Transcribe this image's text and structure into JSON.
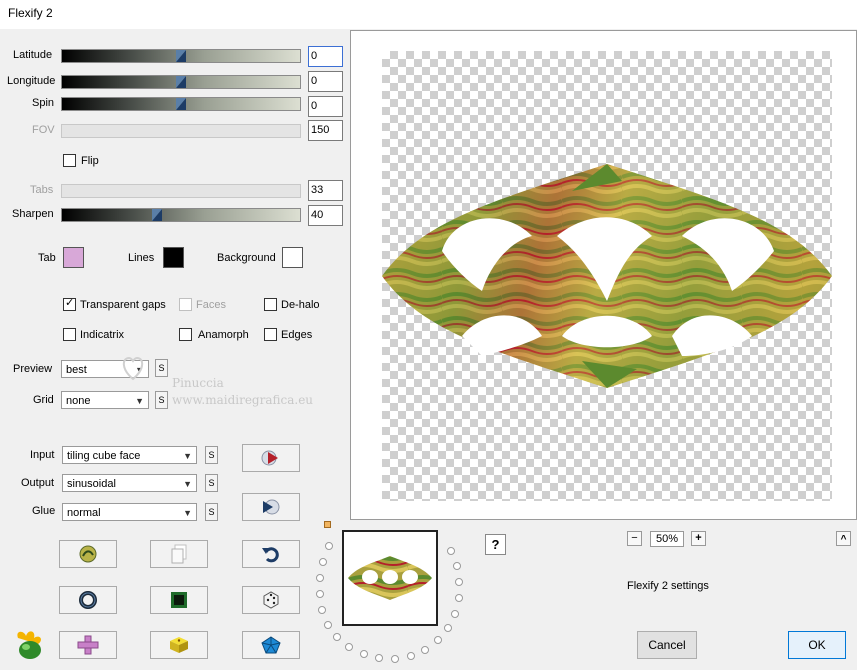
{
  "window": {
    "title": "Flexify 2"
  },
  "sliders": [
    {
      "id": "latitude",
      "label": "Latitude",
      "value": "0",
      "enabled": true,
      "level": 0.5
    },
    {
      "id": "longitude",
      "label": "Longitude",
      "value": "0",
      "enabled": true,
      "level": 0.5
    },
    {
      "id": "spin",
      "label": "Spin",
      "value": "0",
      "enabled": true,
      "level": 0.5
    },
    {
      "id": "fov",
      "label": "FOV",
      "value": "150",
      "enabled": false
    },
    {
      "id": "tabs",
      "label": "Tabs",
      "value": "33",
      "enabled": false
    },
    {
      "id": "sharpen",
      "label": "Sharpen",
      "value": "40",
      "enabled": true,
      "level": 0.4
    }
  ],
  "flip": {
    "label": "Flip",
    "checked": false
  },
  "colors": {
    "tab": {
      "label": "Tab",
      "color": "#d8a8d8"
    },
    "lines": {
      "label": "Lines",
      "color": "#000000"
    },
    "background": {
      "label": "Background",
      "color": "#ffffff"
    }
  },
  "options": {
    "transparent_gaps": {
      "label": "Transparent gaps",
      "checked": true
    },
    "faces": {
      "label": "Faces",
      "checked": false,
      "enabled": false
    },
    "de_halo": {
      "label": "De-halo",
      "checked": false
    },
    "indicatrix": {
      "label": "Indicatrix",
      "checked": false
    },
    "anamorph": {
      "label": "Anamorph",
      "checked": false
    },
    "edges": {
      "label": "Edges",
      "checked": false
    }
  },
  "preview_select": {
    "label": "Preview",
    "value": "best"
  },
  "grid_select": {
    "label": "Grid",
    "value": "none"
  },
  "input_select": {
    "label": "Input",
    "value": "tiling cube face"
  },
  "output_select": {
    "label": "Output",
    "value": "sinusoidal"
  },
  "glue_select": {
    "label": "Glue",
    "value": "normal"
  },
  "s_label": "S",
  "watermark": {
    "line1": "Pinuccia",
    "line2": "www.maidiregrafica.eu"
  },
  "zoom": {
    "minus": "−",
    "value": "50%",
    "plus": "+"
  },
  "help": "?",
  "collapse": "^",
  "settings_label": "Flexify 2 settings",
  "cancel_label": "Cancel",
  "ok_label": "OK",
  "accent": {
    "red": "#b4202a",
    "green": "#5c8a2e",
    "gold": "#c8a53a",
    "blue": "#1d3c66"
  }
}
